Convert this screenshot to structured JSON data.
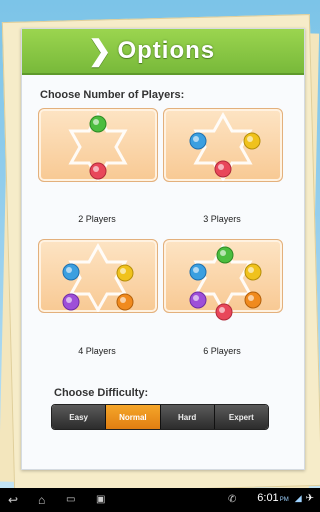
{
  "header": {
    "title": "Options",
    "icon": "chevron-right-icon"
  },
  "players": {
    "label": "Choose Number of Players:",
    "options": [
      {
        "label": "2 Players",
        "count": 2
      },
      {
        "label": "3 Players",
        "count": 3
      },
      {
        "label": "4 Players",
        "count": 4
      },
      {
        "label": "6 Players",
        "count": 6
      }
    ]
  },
  "difficulty": {
    "label": "Choose Difficulty:",
    "options": [
      "Easy",
      "Normal",
      "Hard",
      "Expert"
    ],
    "selected": "Normal"
  },
  "status_bar": {
    "time": "6:01",
    "ampm": "PM",
    "icons": [
      "back-icon",
      "home-icon",
      "recent-apps-icon",
      "screenshot-icon",
      "phone-icon",
      "signal-icon",
      "airplane-icon"
    ]
  },
  "colors": {
    "header_green": "#86c442",
    "selected_orange": "#f0961f",
    "marble_green": "#4bbd3f",
    "marble_red": "#e8475a",
    "marble_blue": "#3b9fe0",
    "marble_yellow": "#f0c21c",
    "marble_purple": "#9e4fd8",
    "marble_orange": "#f08a1e"
  }
}
